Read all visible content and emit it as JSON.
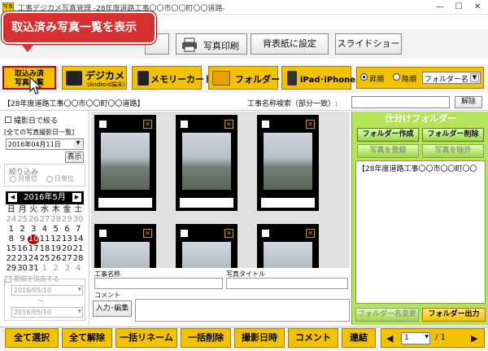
{
  "window": {
    "title": "工事デジカメ写真管理 -28年度道路工事〇〇市〇〇町〇〇道路-",
    "app_icon": "写真",
    "min": "—",
    "max": "☐",
    "close": "✕"
  },
  "callout": {
    "text": "取込済み写真一覧を表示"
  },
  "toolbar1": {
    "button_a": "写真印刷",
    "button_b": "背表紙に設定",
    "button_c": "スライドショー"
  },
  "toolbar2": {
    "imported_line1": "取込み済",
    "imported_line2": "写真一覧",
    "digicam": "デジカメ",
    "digicam_sub": "(Android端末)",
    "memory_card": "メモリーカード",
    "folder": "フォルダー",
    "ipad": "iPad･iPhone",
    "sort_asc": "昇順",
    "sort_desc": "降順",
    "sort_key": "フォルダー名"
  },
  "pathbar": {
    "path": "【28年度道路工事〇〇市〇〇町〇〇道路】",
    "search_label": "工事名称検索（部分一致）:",
    "clear": "解除"
  },
  "left": {
    "narrow_by_date": "撮影日で絞る",
    "all_photo_dates": "[全ての写真撮影日一覧]",
    "date_value": "2016年04月11日",
    "show": "表示",
    "narrow": "絞り込み",
    "by_month": "月単位",
    "by_day": "日単位",
    "calendar": {
      "month": "2016年5月",
      "prev": "◀",
      "next": "▶",
      "weekdays": [
        "日",
        "月",
        "火",
        "水",
        "木",
        "金",
        "土"
      ],
      "days": [
        "24",
        "25",
        "26",
        "27",
        "28",
        "29",
        "30",
        "1",
        "2",
        "3",
        "4",
        "5",
        "6",
        "7",
        "8",
        "9",
        "10",
        "11",
        "12",
        "13",
        "14",
        "15",
        "16",
        "17",
        "18",
        "19",
        "20",
        "21",
        "22",
        "23",
        "24",
        "25",
        "26",
        "27",
        "28",
        "29",
        "30",
        "31",
        "1",
        "2",
        "3",
        "4"
      ],
      "selected": "10"
    },
    "period": "期間を指定する",
    "period_from": "2016/05/10",
    "period_sep": "～",
    "period_to": "2016/05/10"
  },
  "center": {
    "work_name_label": "工事名称",
    "photo_title_label": "写真タイトル",
    "comment_label": "コメント",
    "edit_button": "入力･編集"
  },
  "right": {
    "title": "仕分けフォルダー",
    "create": "フォルダー作成",
    "delete": "フォルダー削除",
    "register": "写真を登録",
    "exclude": "写真を除外",
    "folder_item": "【28年度道路工事〇〇市〇〇町〇〇",
    "rename": "フォルダー名変更",
    "output": "フォルダー出力"
  },
  "bottom": {
    "select_all": "全て選択",
    "deselect_all": "全て解除",
    "bulk_rename": "一括リネーム",
    "bulk_delete": "一括削除",
    "shoot_datetime": "撮影日時",
    "comment": "コメント",
    "join": "連結",
    "page_current": "1",
    "page_total": "/ 1"
  }
}
